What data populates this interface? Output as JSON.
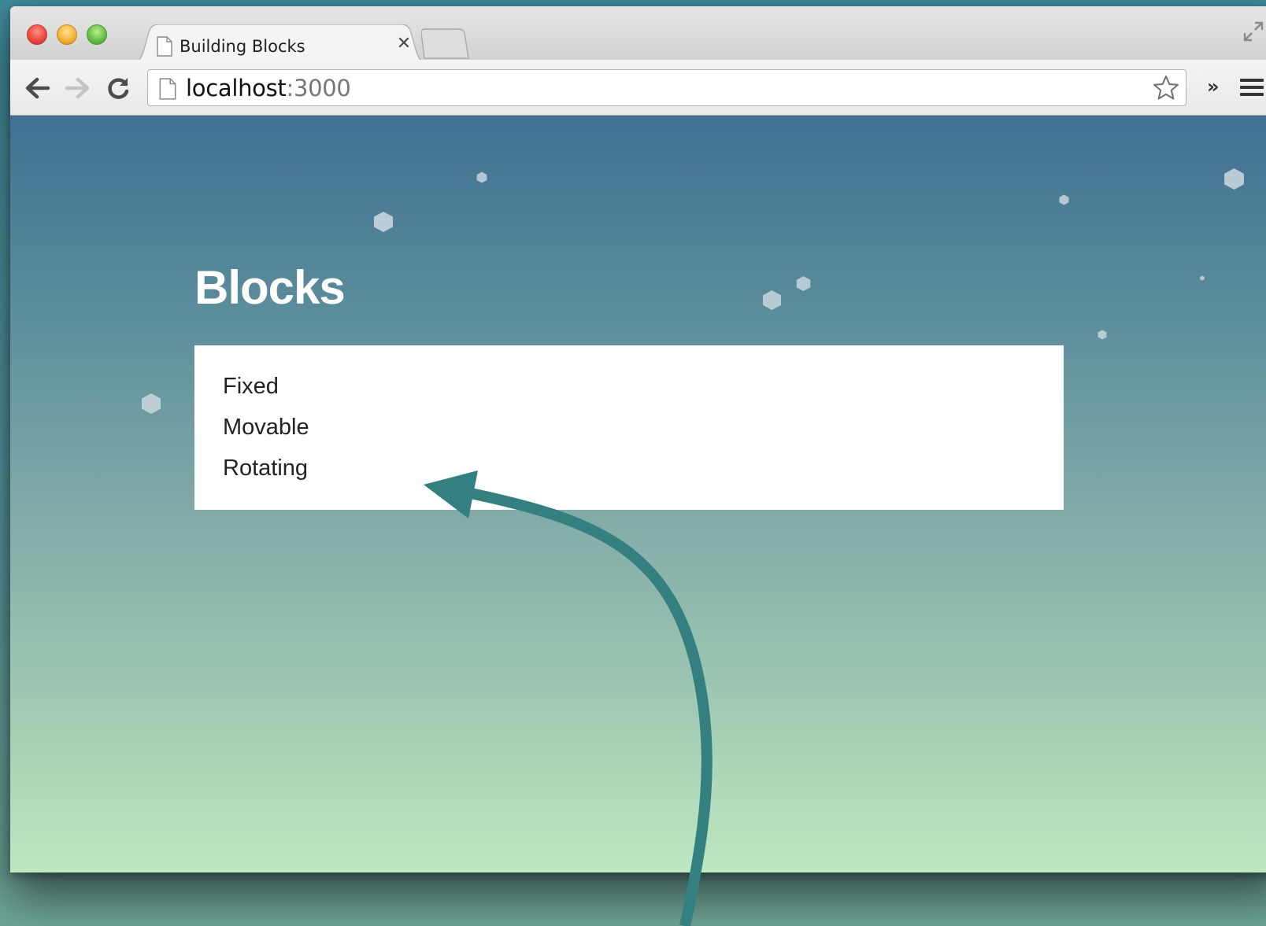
{
  "browser": {
    "tab": {
      "title": "Building Blocks"
    },
    "address": {
      "host": "localhost",
      "port": ":3000"
    }
  },
  "page": {
    "heading": "Blocks",
    "items": [
      {
        "label": "Fixed"
      },
      {
        "label": "Movable"
      },
      {
        "label": "Rotating"
      }
    ]
  },
  "colors": {
    "arrow": "#347f80",
    "heading": "#ffffff",
    "gradient_top": "#416f91",
    "gradient_bottom": "#bee8c0"
  },
  "icons": [
    "close-icon",
    "back-icon",
    "forward-icon",
    "reload-icon",
    "page-icon",
    "star-icon",
    "chevron-icon",
    "menu-icon",
    "fullscreen-icon"
  ]
}
